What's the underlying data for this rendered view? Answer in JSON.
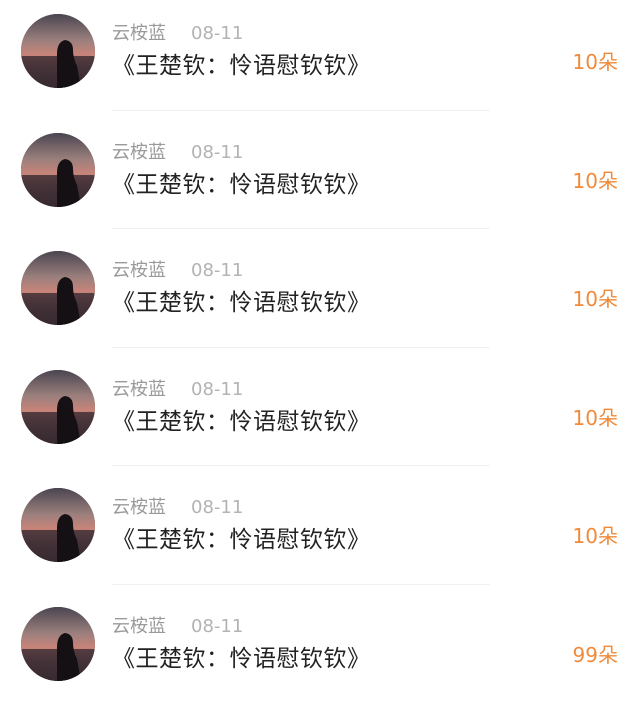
{
  "comments": [
    {
      "user": "云桉蓝",
      "date": "08-11",
      "title": "《王楚钦：怜语慰钦钦》",
      "gift": "10朵",
      "avatar": "avatar-icon"
    },
    {
      "user": "云桉蓝",
      "date": "08-11",
      "title": "《王楚钦：怜语慰钦钦》",
      "gift": "10朵",
      "avatar": "avatar-icon"
    },
    {
      "user": "云桉蓝",
      "date": "08-11",
      "title": "《王楚钦：怜语慰钦钦》",
      "gift": "10朵",
      "avatar": "avatar-icon"
    },
    {
      "user": "云桉蓝",
      "date": "08-11",
      "title": "《王楚钦：怜语慰钦钦》",
      "gift": "10朵",
      "avatar": "avatar-icon"
    },
    {
      "user": "云桉蓝",
      "date": "08-11",
      "title": "《王楚钦：怜语慰钦钦》",
      "gift": "10朵",
      "avatar": "avatar-icon"
    },
    {
      "user": "云桉蓝",
      "date": "08-11",
      "title": "《王楚钦：怜语慰钦钦》",
      "gift": "99朵",
      "avatar": "avatar-icon"
    }
  ],
  "colors": {
    "accent": "#f08a3a",
    "username": "#9a9a9a",
    "date": "#b3b3b3",
    "title": "#222222"
  }
}
